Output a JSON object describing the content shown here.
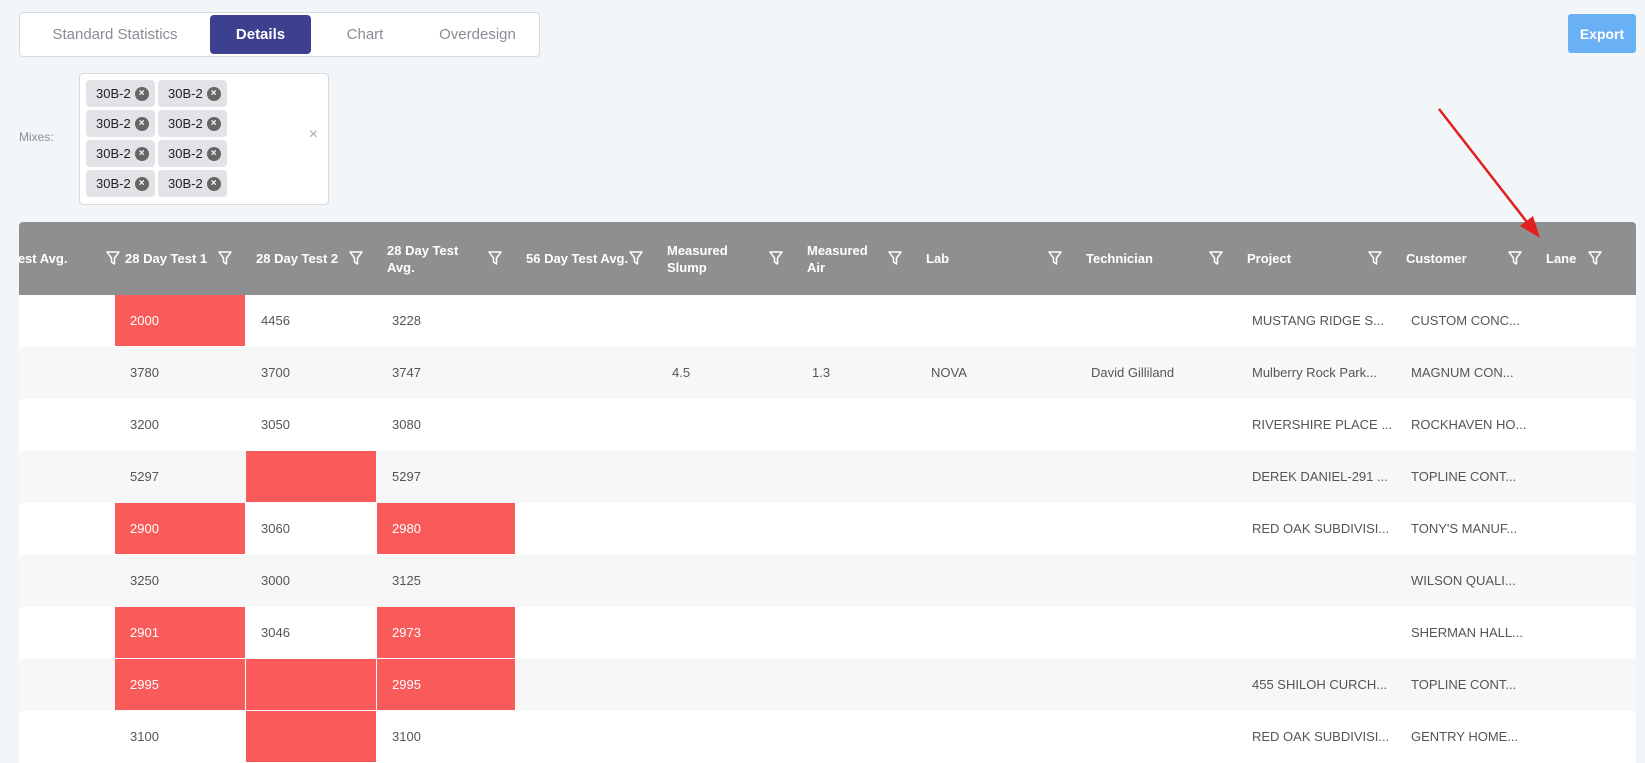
{
  "tabs": [
    {
      "label": "Standard Statistics"
    },
    {
      "label": "Details",
      "active": true
    },
    {
      "label": "Chart"
    },
    {
      "label": "Overdesign"
    }
  ],
  "export_label": "Export",
  "mixes": {
    "label": "Mixes:",
    "chips": [
      "30B-2",
      "30B-2",
      "30B-2",
      "30B-2",
      "30B-2",
      "30B-2",
      "30B-2",
      "30B-2"
    ],
    "clear_icon": "×",
    "chip_remove_icon": "×"
  },
  "colors": {
    "accent": "#3d3f8f",
    "export": "#6ab0f5",
    "header": "#8f8f8f",
    "fail": "#f95a5a",
    "annotation_arrow": "#e02020"
  },
  "table": {
    "columns": [
      "y Test Avg.",
      "28 Day Test 1",
      "28 Day Test 2",
      "28 Day Test Avg.",
      "56 Day Test Avg.",
      "Measured Slump",
      "Measured Air",
      "Lab",
      "Technician",
      "Project",
      "Customer",
      "Lane"
    ],
    "rows": [
      {
        "cells": [
          "",
          "2000",
          "4456",
          "3228",
          "",
          "",
          "",
          "",
          "",
          "MUSTANG RIDGE S...",
          "CUSTOM CONC...",
          ""
        ],
        "red": [
          1
        ]
      },
      {
        "cells": [
          "",
          "3780",
          "3700",
          "3747",
          "",
          "4.5",
          "1.3",
          "NOVA",
          "David Gilliland",
          "Mulberry Rock Park...",
          "MAGNUM CON...",
          ""
        ],
        "red": []
      },
      {
        "cells": [
          "",
          "3200",
          "3050",
          "3080",
          "",
          "",
          "",
          "",
          "",
          "RIVERSHIRE PLACE ...",
          "ROCKHAVEN HO...",
          ""
        ],
        "red": []
      },
      {
        "cells": [
          "",
          "5297",
          "",
          "5297",
          "",
          "",
          "",
          "",
          "",
          "DEREK DANIEL-291 ...",
          "TOPLINE CONT...",
          ""
        ],
        "red": [
          2
        ]
      },
      {
        "cells": [
          "",
          "2900",
          "3060",
          "2980",
          "",
          "",
          "",
          "",
          "",
          "RED OAK SUBDIVISI...",
          "TONY'S MANUF...",
          ""
        ],
        "red": [
          1,
          3
        ]
      },
      {
        "cells": [
          "",
          "3250",
          "3000",
          "3125",
          "",
          "",
          "",
          "",
          "",
          "",
          "WILSON QUALI...",
          ""
        ],
        "red": []
      },
      {
        "cells": [
          "",
          "2901",
          "3046",
          "2973",
          "",
          "",
          "",
          "",
          "",
          "",
          "SHERMAN HALL...",
          ""
        ],
        "red": [
          1,
          3
        ]
      },
      {
        "cells": [
          "",
          "2995",
          "",
          "2995",
          "",
          "",
          "",
          "",
          "",
          "455 SHILOH CURCH...",
          "TOPLINE CONT...",
          ""
        ],
        "red": [
          1,
          2,
          3
        ]
      },
      {
        "cells": [
          "",
          "3100",
          "",
          "3100",
          "",
          "",
          "",
          "",
          "",
          "RED OAK SUBDIVISI...",
          "GENTRY HOME...",
          ""
        ],
        "red": [
          2
        ]
      }
    ]
  }
}
